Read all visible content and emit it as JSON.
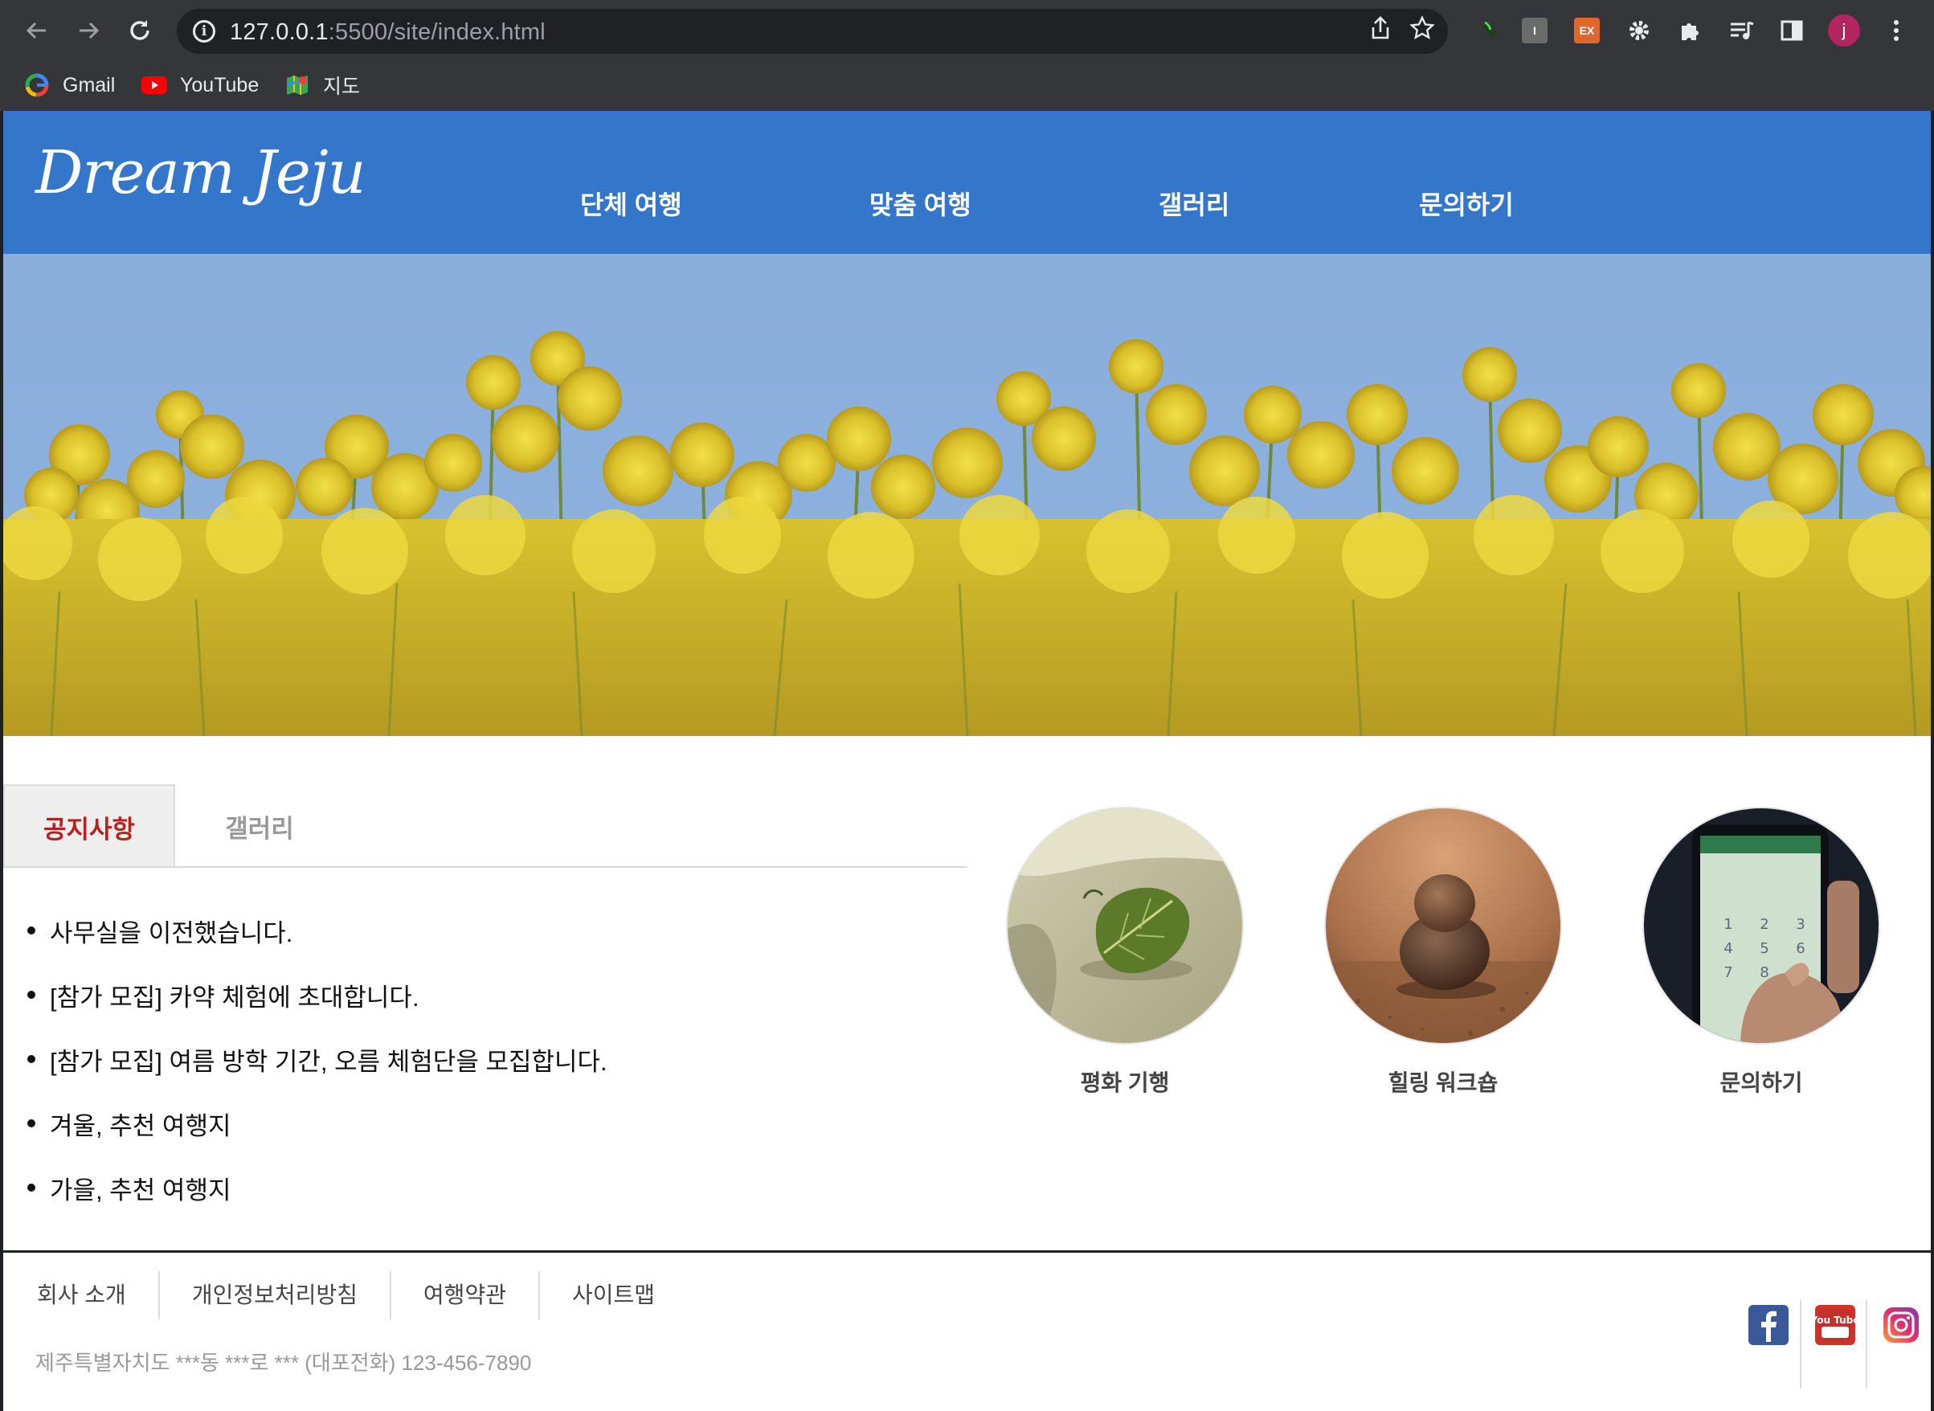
{
  "browser": {
    "url_host": "127.0.0.1",
    "url_rest": ":5500/site/index.html",
    "bookmarks": [
      {
        "label": "Gmail",
        "icon": "google-icon"
      },
      {
        "label": "YouTube",
        "icon": "youtube-icon"
      },
      {
        "label": "지도",
        "icon": "maps-icon"
      }
    ],
    "profile_initial": "j",
    "extensions": [
      "green-leaf-extension-icon",
      "i-extension-icon",
      "ex-extension-icon",
      "gear-extension-icon",
      "puzzle-icon",
      "media-icon",
      "side-panel-icon"
    ],
    "ext_i_label": "I",
    "ext_ex_label": "EX"
  },
  "header": {
    "logo": "Dream Jeju",
    "nav": [
      "단체 여행",
      "맞춤 여행",
      "갤러리",
      "문의하기"
    ],
    "color": "#3476c9"
  },
  "tabs": {
    "active": "공지사항",
    "inactive": "갤러리",
    "active_color": "#b42222"
  },
  "notices": [
    "사무실을 이전했습니다.",
    "[참가 모집] 카약 체험에 초대합니다.",
    "[참가 모집] 여름 방학 기간, 오름 체험단을 모집합니다.",
    "겨울, 추천 여행지",
    "가을, 추천 여행지"
  ],
  "cards": [
    {
      "label": "평화 기행",
      "image": "leaf-on-sand"
    },
    {
      "label": "힐링 워크숍",
      "image": "stacked-stones"
    },
    {
      "label": "문의하기",
      "image": "phone-dialer"
    }
  ],
  "footer": {
    "links": [
      "회사 소개",
      "개인정보처리방침",
      "여행약관",
      "사이트맵"
    ],
    "address": "제주특별자치도 ***동 ***로 *** (대포전화) 123-456-7890",
    "social": [
      "facebook-icon",
      "youtube-icon",
      "instagram-icon"
    ],
    "youtube_text": "You Tube"
  }
}
